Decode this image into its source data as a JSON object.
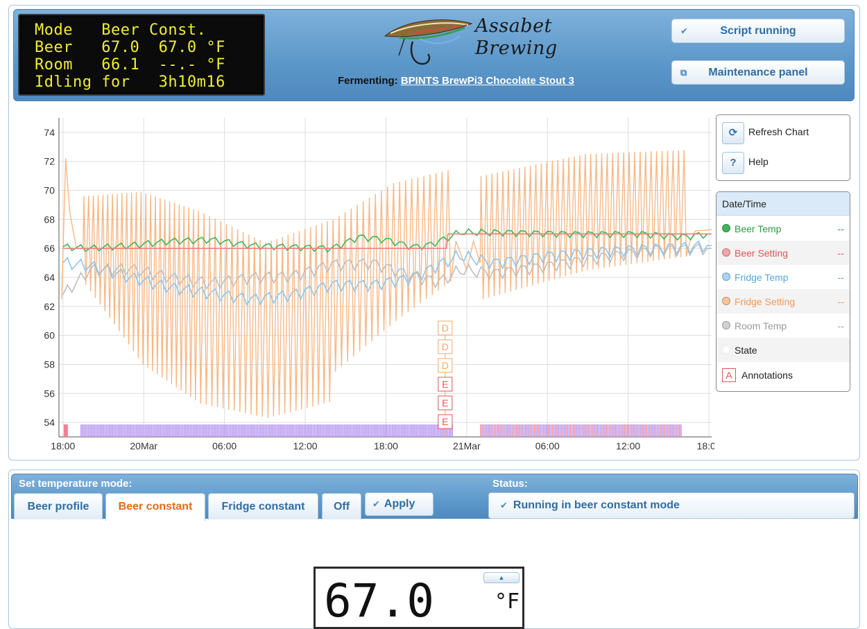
{
  "header": {
    "lcd": [
      "Mode   Beer Const.",
      "Beer   67.0  67.0 °F",
      "Room   66.1  --.- °F",
      "Idling for   3h10m16"
    ],
    "logo": {
      "line1": "Assabet",
      "line2": "Brewing"
    },
    "fermenting_label": "Fermenting:",
    "beer_name": "BPINTS BrewPi3 Chocolate Stout 3",
    "script_button": "Script running",
    "maintenance_button": "Maintenance panel"
  },
  "chart_controls": {
    "refresh": "Refresh Chart",
    "help": "Help",
    "help_icon": "?"
  },
  "legend": {
    "header": "Date/Time",
    "rows": [
      {
        "name": "Beer Temp",
        "value": "--",
        "color": "#3fb557"
      },
      {
        "name": "Beer Setting",
        "value": "--",
        "color": "#f08080"
      },
      {
        "name": "Fridge Temp",
        "value": "--",
        "color": "#8ec5ea"
      },
      {
        "name": "Fridge Setting",
        "value": "--",
        "color": "#f6b07a"
      },
      {
        "name": "Room Temp",
        "value": "--",
        "color": "#bfbfbf"
      },
      {
        "name": "State",
        "value": "",
        "color": "#ffffff"
      }
    ],
    "annotations": "Annotations",
    "annotations_glyph": "A"
  },
  "chart_data": {
    "type": "line",
    "title": "",
    "xlabel": "",
    "ylabel": "",
    "x_ticks": [
      "18:00",
      "20Mar",
      "06:00",
      "12:00",
      "18:00",
      "21Mar",
      "06:00",
      "12:00",
      "18:00"
    ],
    "x_range_hours": [
      -0.3,
      48.2
    ],
    "ylim": [
      53,
      75
    ],
    "y_ticks": [
      54,
      56,
      58,
      60,
      62,
      64,
      66,
      68,
      70,
      72,
      74
    ],
    "grid": true,
    "series": [
      {
        "name": "Beer Temp",
        "color": "#3fb557",
        "points": [
          [
            0,
            66.1
          ],
          [
            2,
            66
          ],
          [
            5,
            66.2
          ],
          [
            8,
            66.5
          ],
          [
            11,
            66.6
          ],
          [
            14,
            66.2
          ],
          [
            17,
            66.1
          ],
          [
            20,
            66
          ],
          [
            22,
            66.8
          ],
          [
            24,
            66.6
          ],
          [
            26,
            66.1
          ],
          [
            27,
            66.2
          ],
          [
            28,
            66.5
          ],
          [
            29.5,
            67.1
          ],
          [
            33,
            67.1
          ],
          [
            38,
            67
          ],
          [
            43,
            67
          ],
          [
            46,
            66.8
          ],
          [
            48.2,
            67
          ]
        ]
      },
      {
        "name": "Beer Setting",
        "color": "#f08080",
        "points": [
          [
            0,
            66
          ],
          [
            28.5,
            66
          ],
          [
            28.6,
            67
          ],
          [
            48.2,
            67
          ]
        ]
      },
      {
        "name": "Fridge Temp",
        "color": "#8ec5ea",
        "points": [
          [
            0,
            65
          ],
          [
            2,
            64.8
          ],
          [
            5,
            64
          ],
          [
            8,
            63.3
          ],
          [
            11,
            62.9
          ],
          [
            14,
            62.5
          ],
          [
            17,
            62.8
          ],
          [
            20,
            63.5
          ],
          [
            23,
            63.5
          ],
          [
            26,
            64
          ],
          [
            28,
            64.9
          ],
          [
            29.5,
            65.5
          ],
          [
            32,
            65
          ],
          [
            36,
            65.5
          ],
          [
            40,
            65.8
          ],
          [
            44,
            66
          ],
          [
            48.2,
            66.2
          ]
        ]
      },
      {
        "name": "Room Temp",
        "color": "#bfbfbf",
        "points": [
          [
            0,
            62.8
          ],
          [
            2,
            64.5
          ],
          [
            5,
            64.6
          ],
          [
            8,
            64
          ],
          [
            11,
            63.6
          ],
          [
            14,
            64
          ],
          [
            17,
            64.1
          ],
          [
            20,
            64.9
          ],
          [
            23,
            65
          ],
          [
            26,
            64.1
          ],
          [
            28,
            63.7
          ],
          [
            29.5,
            64.5
          ],
          [
            32,
            64.3
          ],
          [
            36,
            64.8
          ],
          [
            40,
            65.4
          ],
          [
            44,
            65.9
          ],
          [
            48.2,
            66
          ]
        ]
      }
    ],
    "fridge_setting": {
      "name": "Fridge Setting",
      "color": "#f6b07a",
      "cycles": [
        {
          "start": 1.5,
          "end": 10,
          "top": [
            69.6,
            69.9,
            68.6
          ],
          "bottom": [
            63.5,
            58.0,
            55.3
          ],
          "count": 24
        },
        {
          "start": 10,
          "end": 20,
          "top": [
            68.6,
            66.4,
            68.0
          ],
          "bottom": [
            55.3,
            54.3,
            55.5
          ],
          "count": 24
        },
        {
          "start": 20,
          "end": 29,
          "top": [
            68.0,
            70.5,
            71.5
          ],
          "bottom": [
            57.5,
            61.0,
            64.0
          ],
          "count": 20
        },
        {
          "start": 31,
          "end": 46.5,
          "top": [
            71.0,
            72.5,
            72.8
          ],
          "bottom": [
            62.5,
            64.5,
            65.5
          ],
          "count": 38
        }
      ]
    },
    "annotations": [
      "D",
      "D",
      "D",
      "E",
      "E",
      "E"
    ],
    "state_bands": [
      {
        "from": 1.3,
        "to": 29,
        "color": "#b28ff0"
      },
      {
        "from": 31,
        "to": 46,
        "color": "#d990d8"
      }
    ]
  },
  "mode": {
    "title": "Set temperature mode:",
    "status_title": "Status:",
    "tabs": [
      "Beer profile",
      "Beer constant",
      "Fridge constant",
      "Off"
    ],
    "active_tab": "Beer constant",
    "apply": "Apply",
    "status": "Running in beer constant mode"
  },
  "display": {
    "value": "67.0",
    "unit": "°F"
  }
}
